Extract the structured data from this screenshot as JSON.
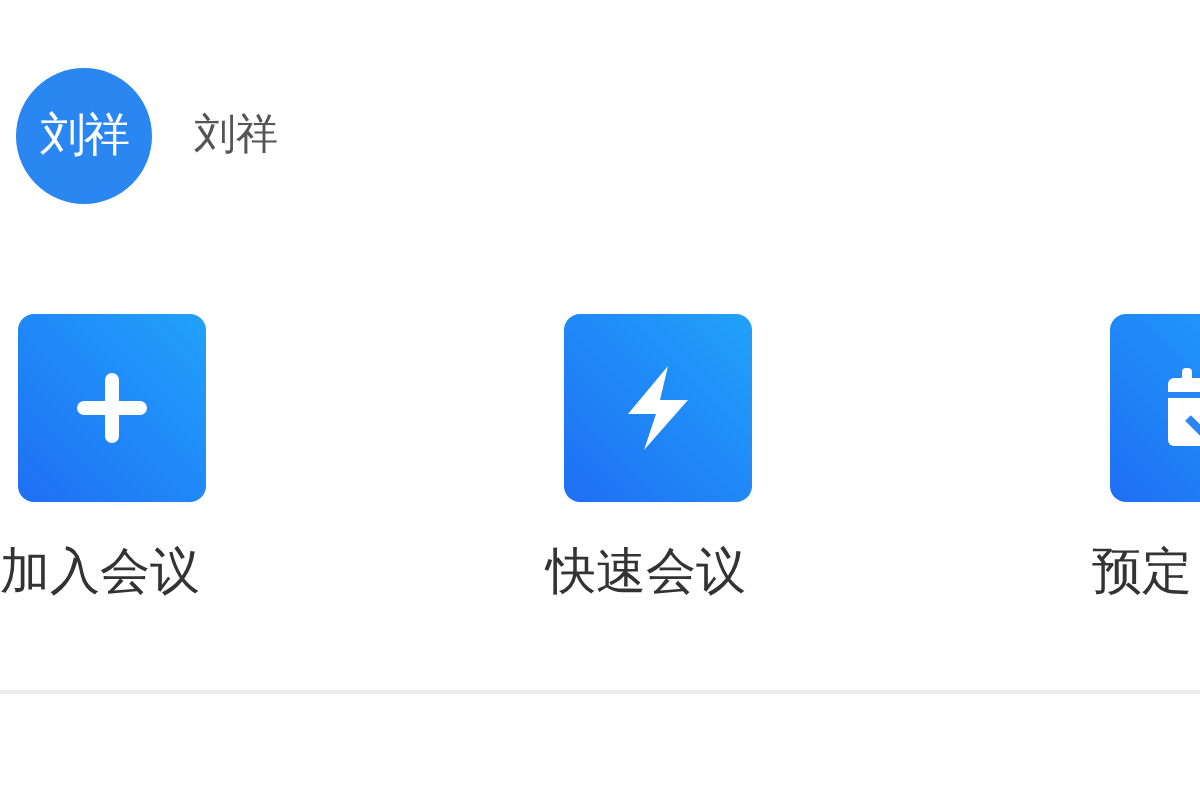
{
  "profile": {
    "avatar_text": "刘祥",
    "name": "刘祥"
  },
  "actions": [
    {
      "kind": "join",
      "label": "加入会议"
    },
    {
      "kind": "quick",
      "label": "快速会议"
    },
    {
      "kind": "schedule",
      "label": "预定"
    }
  ]
}
